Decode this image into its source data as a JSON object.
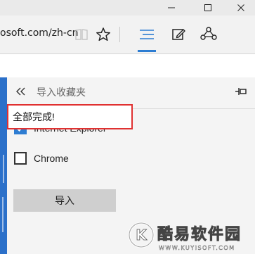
{
  "browser": {
    "url_visible": "osoft.com/zh-cn",
    "window_controls": [
      "minimize-icon",
      "maximize-icon",
      "close-icon"
    ],
    "toolbar_icons": [
      "reading-view-icon",
      "favorite-star-icon",
      "hub-icon",
      "web-note-icon",
      "share-icon"
    ]
  },
  "panel": {
    "title": "导入收藏夹",
    "back_icon": "back-chevron-icon",
    "pin_icon": "pin-icon",
    "sources": [
      {
        "label": "Internet Explorer",
        "checked": true
      },
      {
        "label": "Chrome",
        "checked": false
      }
    ],
    "import_button": "导入"
  },
  "toast": {
    "message": "全部完成!"
  },
  "watermark": {
    "logo_letter": "K",
    "text": "酷易软件园",
    "url": "WWW.KUYISOFT.COM"
  },
  "colors": {
    "accent": "#2d7dd2",
    "highlight_border": "#e03131",
    "panel_bg": "#f4f4f4",
    "button_bg": "#cfcfcf"
  }
}
